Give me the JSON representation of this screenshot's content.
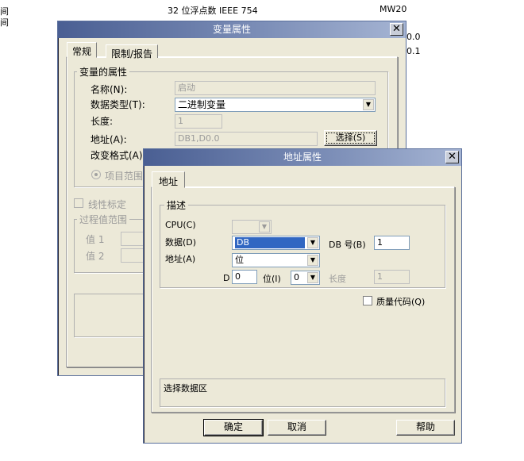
{
  "background": {
    "row1_type": "32 位浮点数 IEEE 754",
    "row1_addr": "MW20",
    "row1_left": "间",
    "row2_left": "间",
    "right_a": "0.0",
    "right_b": "0.1"
  },
  "var_dialog": {
    "title": "变量属性",
    "tabs": [
      "常规",
      "限制/报告"
    ],
    "group_title": "变量的属性",
    "name_label": "名称(N):",
    "name_value": "启动",
    "datatype_label": "数据类型(T):",
    "datatype_value": "二进制变量",
    "length_label": "长度:",
    "length_value": "1",
    "address_label": "地址(A):",
    "address_value": "DB1,D0.0",
    "select_button": "选择(S)",
    "format_label": "改变格式(A)",
    "project_range_label": "项目范围",
    "linear_scale_label": "线性标定",
    "process_range_title": "过程值范围",
    "value1_label": "值 1",
    "value2_label": "值 2"
  },
  "addr_dialog": {
    "title": "地址属性",
    "tab": "地址",
    "group_title": "描述",
    "cpu_label": "CPU(C)",
    "cpu_value": "",
    "data_label": "数据(D)",
    "data_value": "DB",
    "db_no_label": "DB 号(B)",
    "db_no_value": "1",
    "address_label": "地址(A)",
    "address_value": "位",
    "d_label": "D",
    "d_value": "0",
    "bit_label": "位(I)",
    "bit_value": "0",
    "length_label": "长度",
    "length_value": "1",
    "quality_label": "质量代码(Q)",
    "info_text": "选择数据区",
    "ok_button": "确定",
    "cancel_button": "取消",
    "help_button": "帮助"
  }
}
